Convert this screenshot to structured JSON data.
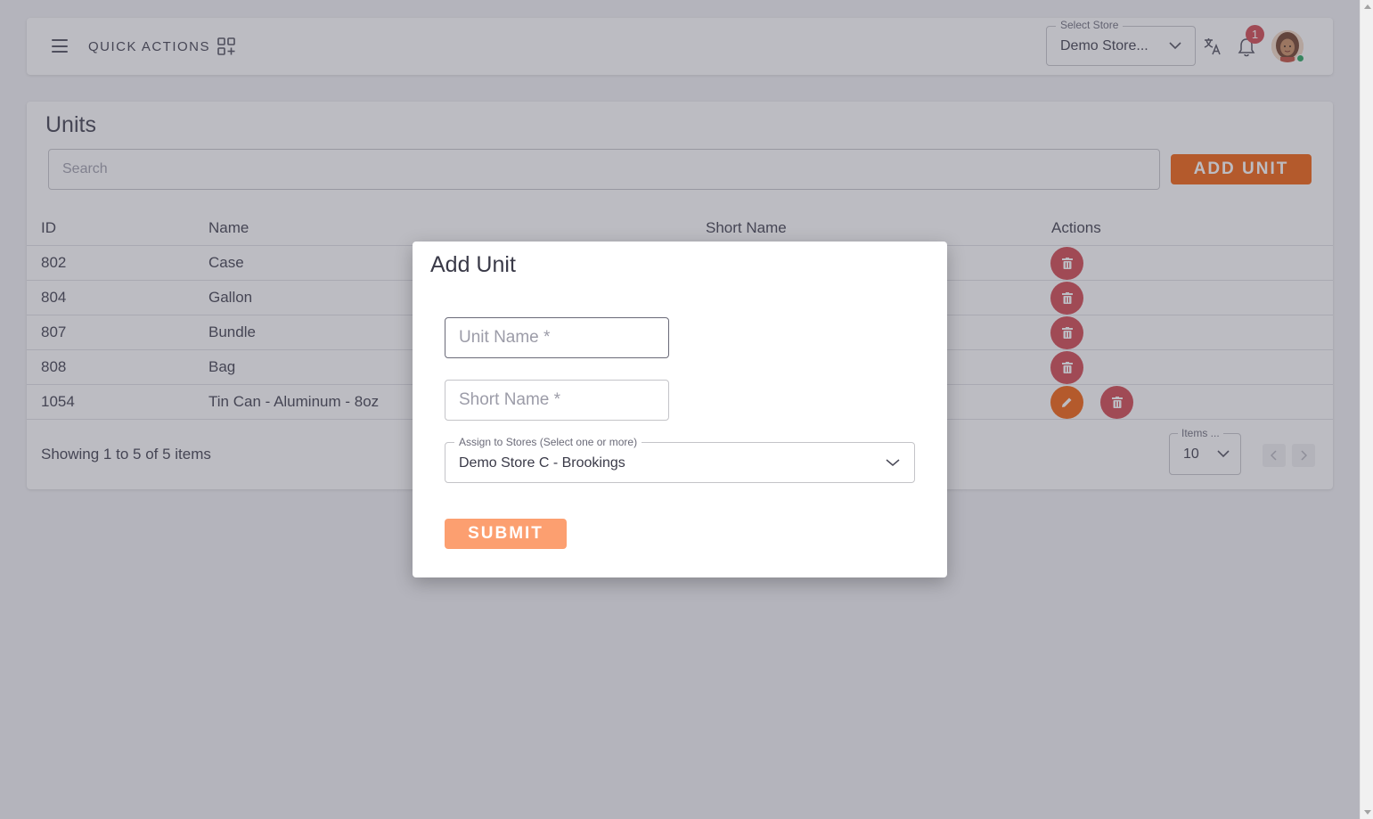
{
  "header": {
    "quick_actions_label": "QUICK ACTIONS",
    "store_select_legend": "Select Store",
    "store_select_value": "Demo Store...",
    "notification_count": "1",
    "icons": [
      "hamburger-icon",
      "grid-plus-icon",
      "chevron-down-icon",
      "translate-icon",
      "bell-icon",
      "avatar"
    ]
  },
  "page": {
    "title": "Units",
    "search_placeholder": "Search",
    "add_button_label": "ADD UNIT"
  },
  "table": {
    "columns": [
      "ID",
      "Name",
      "Short Name",
      "Actions"
    ],
    "rows": [
      {
        "id": "802",
        "name": "Case",
        "short_name": "",
        "editable": false
      },
      {
        "id": "804",
        "name": "Gallon",
        "short_name": "",
        "editable": false
      },
      {
        "id": "807",
        "name": "Bundle",
        "short_name": "",
        "editable": false
      },
      {
        "id": "808",
        "name": "Bag",
        "short_name": "",
        "editable": false
      },
      {
        "id": "1054",
        "name": "Tin Can - Aluminum - 8oz",
        "short_name": "",
        "editable": true
      }
    ],
    "showing_text": "Showing 1 to 5 of 5 items",
    "items_per_page_legend": "Items ...",
    "items_per_page_value": "10"
  },
  "modal": {
    "title": "Add Unit",
    "unit_name_placeholder": "Unit Name *",
    "short_name_placeholder": "Short Name *",
    "assign_legend": "Assign to Stores (Select one or more)",
    "assign_value": "Demo Store C - Brookings",
    "submit_label": "SUBMIT"
  },
  "colors": {
    "accent": "#f25c05",
    "submit_disabled": "#fc9f70",
    "delete": "#d1414a",
    "badge": "#d1414a",
    "online": "#22a35a"
  }
}
